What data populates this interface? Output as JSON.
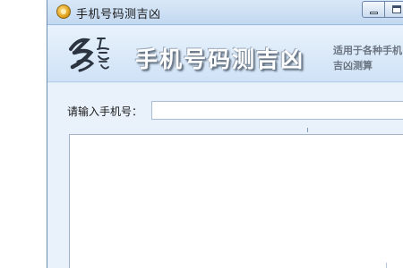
{
  "window": {
    "title": "手机号码测吉凶",
    "icon": "app-coin-icon"
  },
  "banner": {
    "logo": "名-calligraphy-logo-icon",
    "title": "手机号码测吉凶",
    "desc_line1": "适用于各种手机",
    "desc_line2": "吉凶测算"
  },
  "form": {
    "phone_label": "请输入手机号：",
    "phone_value": "",
    "phone_placeholder": ""
  },
  "results": {
    "text": ""
  },
  "colors": {
    "window_bg": "#dbe9f8",
    "banner_text": "#ffffff",
    "desc_text": "#6c7682",
    "logo_ink": "#2b3440"
  }
}
